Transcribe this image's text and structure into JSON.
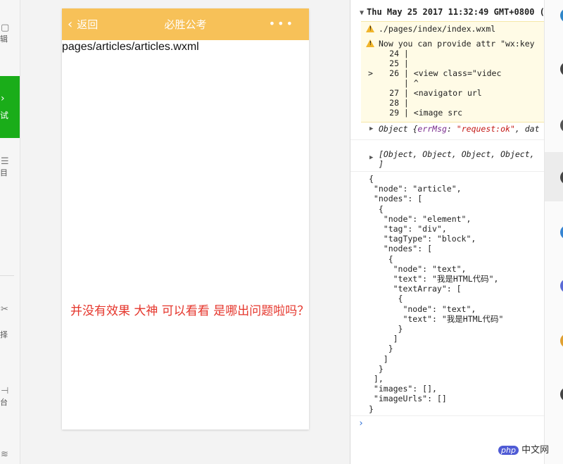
{
  "left_sidebar": {
    "items": [
      {
        "label": "辑",
        "icon": "edit-icon"
      },
      {
        "label": "试",
        "icon": "debug-chevron-icon"
      },
      {
        "label": "目",
        "icon": "project-icon"
      },
      {
        "label": "择",
        "icon": "cut-icon"
      },
      {
        "label": "台",
        "icon": "backend-icon"
      },
      {
        "label": "",
        "icon": "layers-icon"
      }
    ],
    "active_color": "#1aad19"
  },
  "simulator": {
    "nav": {
      "back_label": "返回",
      "title": "必胜公考",
      "more": "•••",
      "color": "#f7c158"
    },
    "page_path": "pages/articles/articles.wxml"
  },
  "annotation": {
    "text": "并没有效果 大神 可以看看 是哪出问题啦吗？",
    "color": "#e5362c"
  },
  "console": {
    "header": "Thu May 25 2017 11:32:49 GMT+0800 (",
    "warnings": [
      "./pages/index/index.wxml",
      "Now you can provide attr \"wx:key"
    ],
    "code_lines": [
      {
        "num": "24",
        "code": ""
      },
      {
        "num": "25",
        "code": ""
      },
      {
        "num": "26",
        "code": "        <view class=\"videc"
      },
      {
        "num": "",
        "code": "          ^"
      },
      {
        "num": "27",
        "code": "            <navigator url"
      },
      {
        "num": "28",
        "code": ""
      },
      {
        "num": "29",
        "code": "                <image src"
      }
    ],
    "object1": {
      "prefix": "Object {",
      "key": "errMsg",
      "sep": ": ",
      "value": "\"request:ok\"",
      "rest": ", dat"
    },
    "object2": {
      "line1": "[Object, Object, Object, Object,",
      "line2": "]"
    },
    "json": [
      "{",
      " \"node\": \"article\",",
      " \"nodes\": [",
      "  {",
      "   \"node\": \"element\",",
      "   \"tag\": \"div\",",
      "   \"tagType\": \"block\",",
      "   \"nodes\": [",
      "    {",
      "     \"node\": \"text\",",
      "     \"text\": \"我是HTML代码\",",
      "     \"textArray\": [",
      "      {",
      "       \"node\": \"text\",",
      "       \"text\": \"我是HTML代码\"",
      "      }",
      "     ]",
      "    }",
      "   ]",
      "  }",
      " ],",
      " \"images\": [],",
      " \"imageUrls\": []",
      "}"
    ],
    "prompt": "›",
    "warn_bg": "#fffbe6",
    "string_color": "#c41a16",
    "key_color": "#7b2d8e"
  },
  "watermark": {
    "badge": "php",
    "text": "中文网"
  }
}
